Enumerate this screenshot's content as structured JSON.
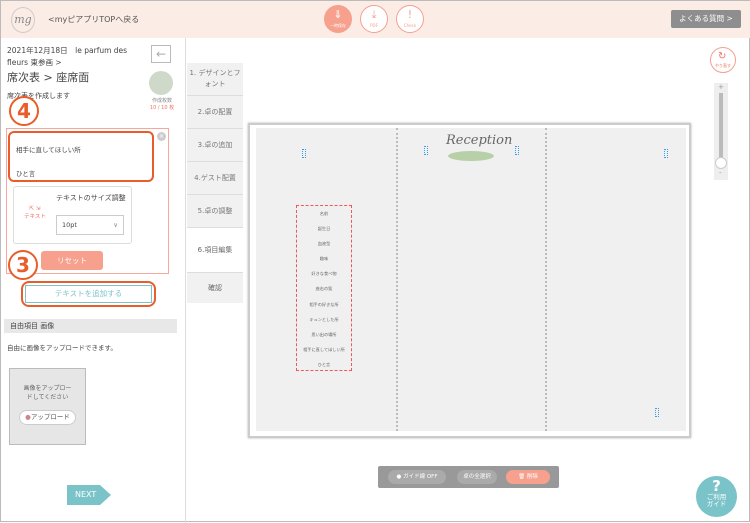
{
  "header": {
    "logo": "mg",
    "back_link": "<myピアプリTOPへ戻る",
    "buttons": [
      {
        "label": "一時保存",
        "icon": "download-icon"
      },
      {
        "label": "PDF",
        "icon": "pdf-download-icon"
      },
      {
        "label": "Check",
        "icon": "exclamation-icon"
      }
    ],
    "faq": "よくある質問 >"
  },
  "left": {
    "date_line": "2021年12月18日　le parfum des fleurs 東参画 >",
    "title": "席次表 > 座席面",
    "subtitle": "席次表を作成します",
    "count_label": "作成枚数",
    "count": "10 / 10 枚",
    "step_badge_4": "4",
    "text_lines": [
      "相手に直してほしい所",
      "ひと言"
    ],
    "size_label": "テキストのサイズ調整",
    "size_icon_label": "テキスト",
    "size_value": "10pt",
    "step_badge_3": "3",
    "reset": "リセット",
    "add_text": "テキストを追加する",
    "section": "自由項目 画像",
    "section_desc": "自由に画像をアップロードできます。",
    "upload_prompt": "画像をアップロードしてください",
    "upload_button": "アップロード",
    "next": "NEXT"
  },
  "steps": [
    "1. デザインとフォント",
    "2.卓の配置",
    "3.卓の追加",
    "4.ゲスト配置",
    "5.卓の調整",
    "6.項目編集"
  ],
  "confirm": "確認",
  "canvas": {
    "title": "Reception",
    "items": [
      "名前",
      "誕生日",
      "血液型",
      "趣味",
      "好きな食べ物",
      "座右の銘",
      "相手の好きな所",
      "キュンとした所",
      "思い出の場所",
      "相手に直してほしい所",
      "ひと言"
    ]
  },
  "controls": {
    "redo": "やり直す",
    "zoom_plus": "+",
    "zoom_minus": "-",
    "zoom_level": 0
  },
  "toolbar": {
    "guide": "ガイド線 OFF",
    "select_all": "卓の全選択",
    "delete": "削除"
  },
  "help": {
    "mark": "?",
    "label": "ご利用ガイド"
  },
  "colors": {
    "accent": "#f7a08e",
    "teal": "#7ac3c9",
    "highlight": "#e85d2a"
  }
}
